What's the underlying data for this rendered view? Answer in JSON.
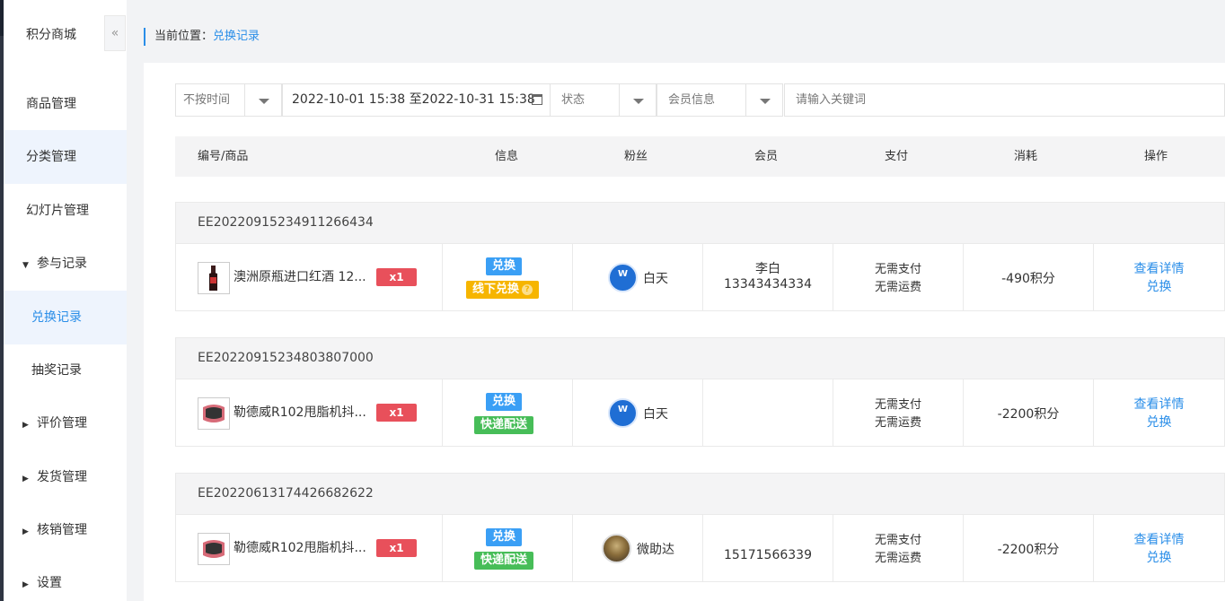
{
  "sidebar": {
    "brand": "积分商城",
    "collapse_icon": "«",
    "items": [
      {
        "label": "商品管理"
      },
      {
        "label": "分类管理"
      },
      {
        "label": "幻灯片管理"
      },
      {
        "label": "参与记录"
      },
      {
        "label": "兑换记录"
      },
      {
        "label": "抽奖记录"
      },
      {
        "label": "评价管理"
      },
      {
        "label": "发货管理"
      },
      {
        "label": "核销管理"
      },
      {
        "label": "设置"
      }
    ]
  },
  "breadcrumb": {
    "prefix": "当前位置：",
    "current": "兑换记录"
  },
  "filters": {
    "time_mode": "不按时间",
    "date_range": "2022-10-01 15:38 至2022-10-31 15:38",
    "status_placeholder": "状态",
    "member_placeholder": "会员信息",
    "keyword_placeholder": "请输入关键词"
  },
  "table": {
    "headers": [
      "编号/商品",
      "信息",
      "粉丝",
      "会员",
      "支付",
      "消耗",
      "操作"
    ]
  },
  "orders": [
    {
      "id": "EE20220915234911266434",
      "product": "澳洲原瓶进口红酒 12...",
      "qty": "x1",
      "type": "兑换",
      "delivery": "线下兑换",
      "fan": "白天",
      "member_name": "李白",
      "member_phone": "13343434334",
      "pay1": "无需支付",
      "pay2": "无需运费",
      "cost": "-490积分",
      "action1": "查看详情",
      "action2": "兑换"
    },
    {
      "id": "EE20220915234803807000",
      "product": "勒德威R102甩脂机抖...",
      "qty": "x1",
      "type": "兑换",
      "delivery": "快递配送",
      "fan": "白天",
      "member_name": "",
      "member_phone": "",
      "pay1": "无需支付",
      "pay2": "无需运费",
      "cost": "-2200积分",
      "action1": "查看详情",
      "action2": "兑换"
    },
    {
      "id": "EE20220613174426682622",
      "product": "勒德威R102甩脂机抖...",
      "qty": "x1",
      "type": "兑换",
      "delivery": "快递配送",
      "fan": "微助达",
      "member_name": "",
      "member_phone": "15171566339",
      "pay1": "无需支付",
      "pay2": "无需运费",
      "cost": "-2200积分",
      "action1": "查看详情",
      "action2": "兑换"
    }
  ]
}
